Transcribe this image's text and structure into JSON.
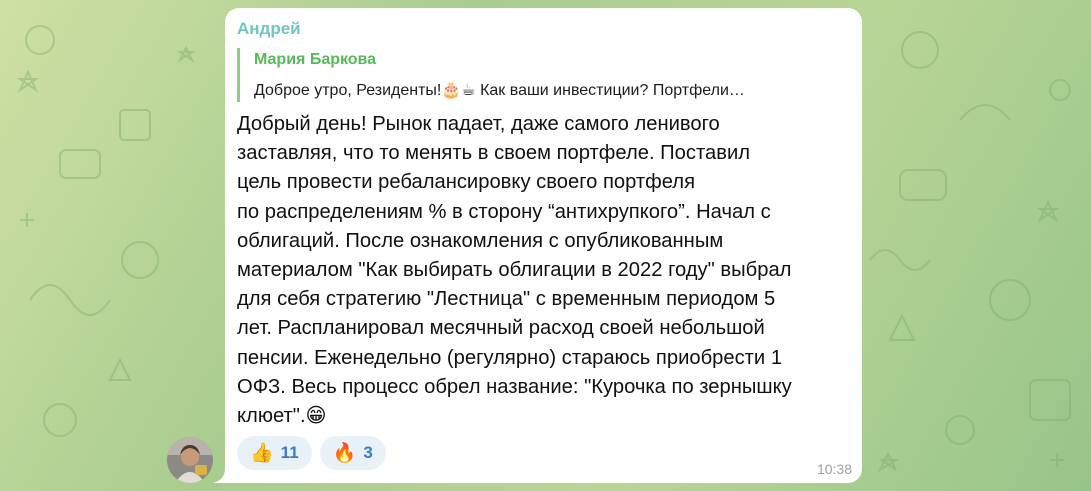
{
  "message": {
    "sender": "Андрей",
    "reply": {
      "author": "Мария Баркова",
      "text": "Доброе утро, Резиденты!🎂☕ Как ваши инвестиции? Портфели…"
    },
    "text": "Добрый день! Рынок падает, даже самого ленивого\nзаставляя, что то менять в своем портфеле. Поставил\nцель провести ребалансировку своего портфеля\nпо распределениям % в сторону “антихрупкого”. Начал с\nоблигаций. После ознакомления с опубликованным\nматериалом \"Как выбирать облигации в 2022 году\" выбрал\nдля себя стратегию \"Лестница\" с временным периодом 5\nлет. Распланировал месячный расход своей небольшой\nпенсии. Еженедельно (регулярно) стараюсь приобрести 1\nОФЗ. Весь процесс обрел название: \"Курочка по зернышку\nклюет\".😁",
    "time": "10:38",
    "reactions": [
      {
        "emoji": "👍",
        "count": "11"
      },
      {
        "emoji": "🔥",
        "count": "3"
      }
    ]
  },
  "colors": {
    "sender": "#6fc6c3",
    "reply_author": "#59b85a",
    "reaction_count": "#3a7bc8",
    "bubble": "#ffffff"
  },
  "icons": {
    "avatar": "user-avatar-photo"
  }
}
